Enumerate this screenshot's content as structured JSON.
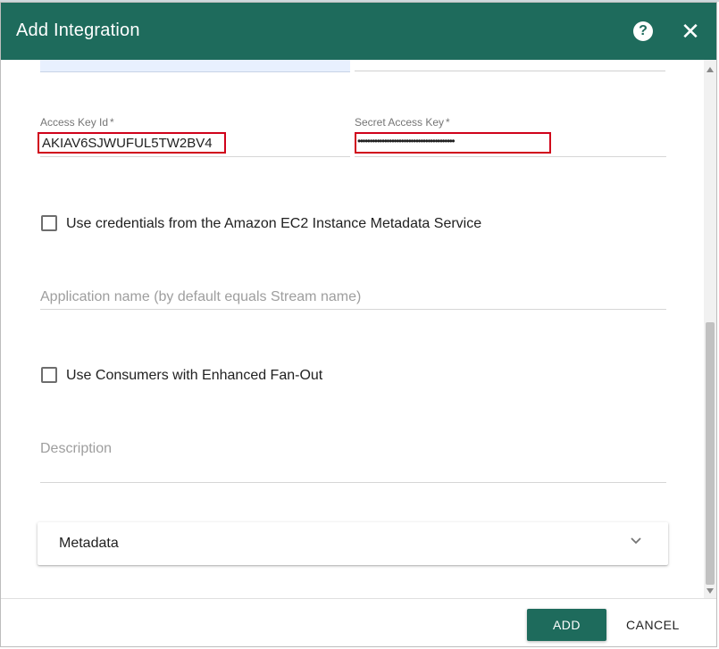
{
  "dialog": {
    "title": "Add Integration",
    "help_icon": "question-circle-icon",
    "close_icon": "close-icon"
  },
  "form": {
    "access_key_id": {
      "label": "Access Key Id",
      "required_mark": "*",
      "value": "AKIAV6SJWUFUL5TW2BV4"
    },
    "secret_access_key": {
      "label": "Secret Access Key",
      "required_mark": "*",
      "value": "••••••••••••••••••••••••••••••••••••••••"
    },
    "use_ec2_metadata": {
      "label": "Use credentials from the Amazon EC2 Instance Metadata Service",
      "checked": false
    },
    "application_name": {
      "placeholder": "Application name (by default equals Stream name)"
    },
    "enhanced_fanout": {
      "label": "Use Consumers with Enhanced Fan-Out",
      "checked": false
    },
    "description": {
      "placeholder": "Description"
    },
    "metadata": {
      "label": "Metadata",
      "icon": "chevron-down-icon"
    }
  },
  "footer": {
    "add_label": "ADD",
    "cancel_label": "CANCEL"
  },
  "colors": {
    "header": "#1e6b5c",
    "primary_button": "#1e6b5c",
    "highlight_box": "#d0021b"
  }
}
